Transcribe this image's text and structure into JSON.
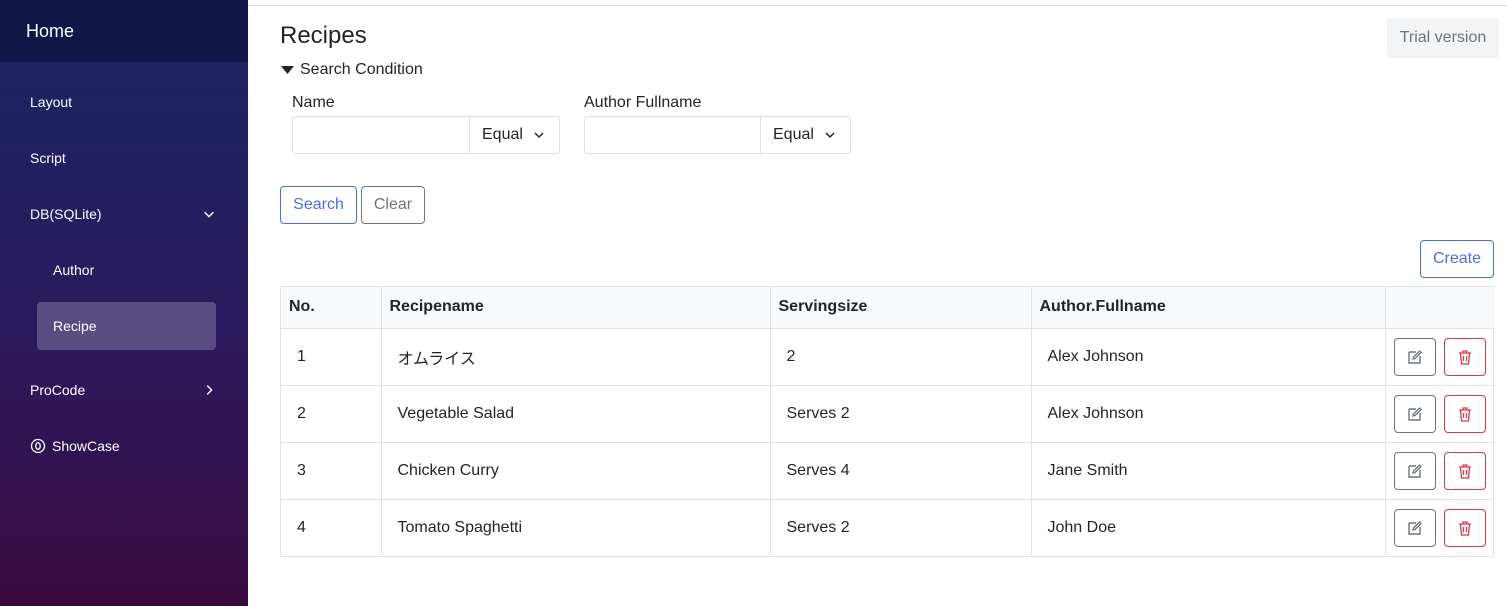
{
  "sidebar": {
    "brand": "Home",
    "items": [
      {
        "label": "Layout"
      },
      {
        "label": "Script"
      },
      {
        "label": "DB(SQLite)"
      },
      {
        "label": "Author"
      },
      {
        "label": "Recipe"
      },
      {
        "label": "ProCode"
      },
      {
        "label": "ShowCase"
      }
    ]
  },
  "header": {
    "title": "Recipes",
    "trial": "Trial version"
  },
  "search": {
    "toggle_label": "Search Condition",
    "fields": [
      {
        "label": "Name",
        "value": "",
        "operator": "Equal"
      },
      {
        "label": "Author Fullname",
        "value": "",
        "operator": "Equal"
      }
    ],
    "search_label": "Search",
    "clear_label": "Clear"
  },
  "create_label": "Create",
  "table": {
    "columns": [
      "No.",
      "Recipename",
      "Servingsize",
      "Author.Fullname",
      ""
    ],
    "rows": [
      {
        "no": "1",
        "recipename": "オムライス",
        "servingsize": "2",
        "author": "Alex Johnson"
      },
      {
        "no": "2",
        "recipename": "Vegetable Salad",
        "servingsize": "Serves 2",
        "author": "Alex Johnson"
      },
      {
        "no": "3",
        "recipename": "Chicken Curry",
        "servingsize": "Serves 4",
        "author": "Jane Smith"
      },
      {
        "no": "4",
        "recipename": "Tomato Spaghetti",
        "servingsize": "Serves 2",
        "author": "John Doe"
      }
    ]
  },
  "colors": {
    "primary": "#4a6fd6",
    "danger": "#dc3545",
    "secondary": "#6c757d"
  },
  "icons": {
    "edit": "pencil-square-icon",
    "delete": "trash-icon",
    "expand": "chevron-down-icon",
    "collapsed": "chevron-right-icon",
    "showcase": "circle-zero-icon"
  }
}
